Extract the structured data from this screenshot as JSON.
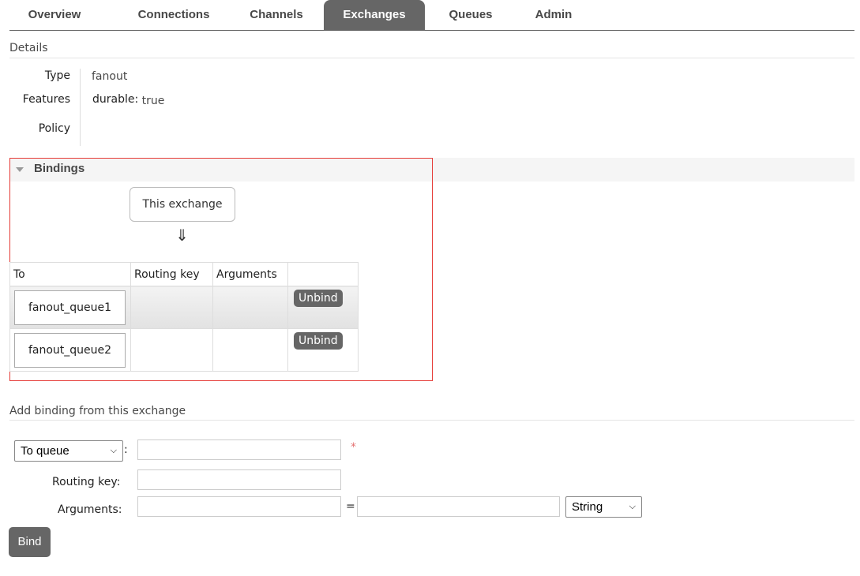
{
  "nav": {
    "tabs": [
      {
        "label": "Overview"
      },
      {
        "label": "Connections"
      },
      {
        "label": "Channels"
      },
      {
        "label": "Exchanges"
      },
      {
        "label": "Queues"
      },
      {
        "label": "Admin"
      }
    ],
    "active": "Exchanges"
  },
  "details": {
    "title": "Details",
    "type_label": "Type",
    "type_value": "fanout",
    "features_label": "Features",
    "features_key": "durable:",
    "features_value": "true",
    "policy_label": "Policy"
  },
  "bindings": {
    "title": "Bindings",
    "this_exchange": "This exchange",
    "arrow": "⇓",
    "columns": [
      "To",
      "Routing key",
      "Arguments",
      ""
    ],
    "rows": [
      {
        "to": "fanout_queue1",
        "routing_key": "",
        "arguments": "",
        "action": "Unbind"
      },
      {
        "to": "fanout_queue2",
        "routing_key": "",
        "arguments": "",
        "action": "Unbind"
      }
    ]
  },
  "add_binding": {
    "title": "Add binding from this exchange",
    "destination_type": "To queue",
    "colon": ":",
    "required_mark": "*",
    "routing_key_label": "Routing key:",
    "arguments_label": "Arguments:",
    "equals": "=",
    "arg_type": "String",
    "bind_button": "Bind"
  },
  "colors": {
    "active_tab": "#666666",
    "highlight_border": "#e53935",
    "required": "#e57373"
  }
}
